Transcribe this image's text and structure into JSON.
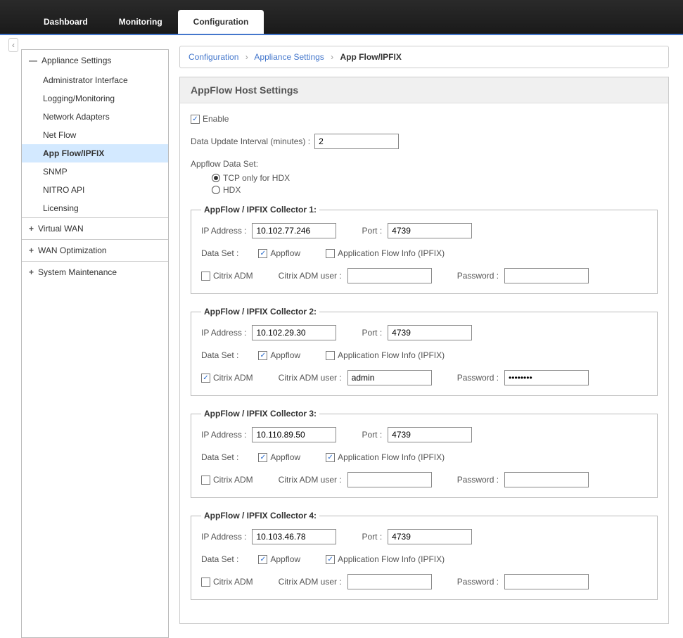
{
  "tabs": {
    "dashboard": "Dashboard",
    "monitoring": "Monitoring",
    "configuration": "Configuration"
  },
  "sidebar": {
    "appliance": {
      "header": "Appliance Settings",
      "items": [
        "Administrator Interface",
        "Logging/Monitoring",
        "Network Adapters",
        "Net Flow",
        "App Flow/IPFIX",
        "SNMP",
        "NITRO API",
        "Licensing"
      ]
    },
    "virtualwan": "Virtual WAN",
    "wanopt": "WAN Optimization",
    "sysmaint": "System Maintenance"
  },
  "breadcrumb": {
    "seg1": "Configuration",
    "seg2": "Appliance Settings",
    "seg3": "App Flow/IPFIX"
  },
  "panel": {
    "title": "AppFlow Host Settings",
    "enable_label": "Enable",
    "update_label": "Data Update Interval (minutes) :",
    "update_value": "2",
    "dataset_label": "Appflow Data Set:",
    "radio_tcp": "TCP only for HDX",
    "radio_hdx": "HDX"
  },
  "coll_labels": {
    "ip": "IP Address :",
    "port": "Port :",
    "dataset": "Data Set :",
    "appflow": "Appflow",
    "ipfix": "Application Flow Info (IPFIX)",
    "adm": "Citrix ADM",
    "adm_user": "Citrix ADM user :",
    "password": "Password :"
  },
  "collectors": [
    {
      "legend": "AppFlow / IPFIX Collector 1:",
      "ip": "10.102.77.246",
      "port": "4739",
      "appflow": true,
      "ipfix": false,
      "adm": false,
      "adm_user": "",
      "password": ""
    },
    {
      "legend": "AppFlow / IPFIX Collector 2:",
      "ip": "10.102.29.30",
      "port": "4739",
      "appflow": true,
      "ipfix": false,
      "adm": true,
      "adm_user": "admin",
      "password": "••••••••"
    },
    {
      "legend": "AppFlow / IPFIX Collector 3:",
      "ip": "10.110.89.50",
      "port": "4739",
      "appflow": true,
      "ipfix": true,
      "adm": false,
      "adm_user": "",
      "password": ""
    },
    {
      "legend": "AppFlow / IPFIX Collector 4:",
      "ip": "10.103.46.78",
      "port": "4739",
      "appflow": true,
      "ipfix": true,
      "adm": false,
      "adm_user": "",
      "password": ""
    }
  ]
}
